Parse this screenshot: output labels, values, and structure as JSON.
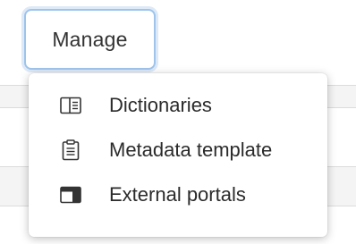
{
  "manage_button": {
    "label": "Manage",
    "focus_color": "#9ec4ec"
  },
  "menu": {
    "items": [
      {
        "label": "Dictionaries",
        "icon": "dictionary-icon"
      },
      {
        "label": "Metadata template",
        "icon": "clipboard-icon"
      },
      {
        "label": "External portals",
        "icon": "portal-icon"
      }
    ]
  }
}
